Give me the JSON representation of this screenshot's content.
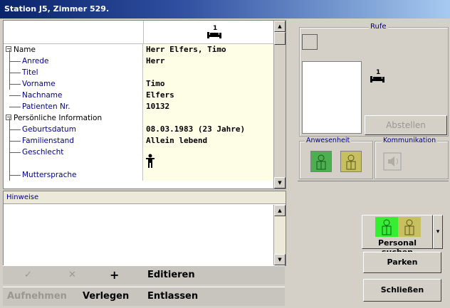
{
  "window": {
    "title": "Station J5, Zimmer 529."
  },
  "grid": {
    "bed_number": "1",
    "rows": [
      {
        "label": "Name",
        "value": "Herr Elfers, Timo"
      },
      {
        "label": "Anrede",
        "value": "Herr"
      },
      {
        "label": "Titel",
        "value": ""
      },
      {
        "label": "Vorname",
        "value": "Timo"
      },
      {
        "label": "Nachname",
        "value": "Elfers"
      },
      {
        "label": "Patienten Nr.",
        "value": "10132"
      },
      {
        "label": "Persönliche Information",
        "value": ""
      },
      {
        "label": "Geburtsdatum",
        "value": "08.03.1983 (23 Jahre)"
      },
      {
        "label": "Familienstand",
        "value": "Allein lebend"
      },
      {
        "label": "Geschlecht",
        "value": ""
      },
      {
        "label": "Muttersprache",
        "value": ""
      }
    ],
    "gender_icon": "male-icon"
  },
  "hinweise": {
    "header": "Hinweise",
    "text": ""
  },
  "toolbar1": {
    "check": "✓",
    "cancel": "✕",
    "add": "+",
    "edit": "Editieren"
  },
  "toolbar2": {
    "aufnehmen": "Aufnehmen",
    "verlegen": "Verlegen",
    "entlassen": "Entlassen"
  },
  "rufe": {
    "label": "Rufe",
    "bed_number": "1",
    "abstellen": "Abstellen"
  },
  "anwesenheit": {
    "label": "Anwesenheit"
  },
  "kommunikation": {
    "label": "Kommunikation",
    "icon": "speaker-icon"
  },
  "personal": {
    "label": "Personal suchen"
  },
  "buttons": {
    "parken": "Parken",
    "schliessen": "Schließen"
  },
  "colors": {
    "green": "#4caf50",
    "olive": "#c8c060",
    "bright_green": "#33ee33"
  }
}
